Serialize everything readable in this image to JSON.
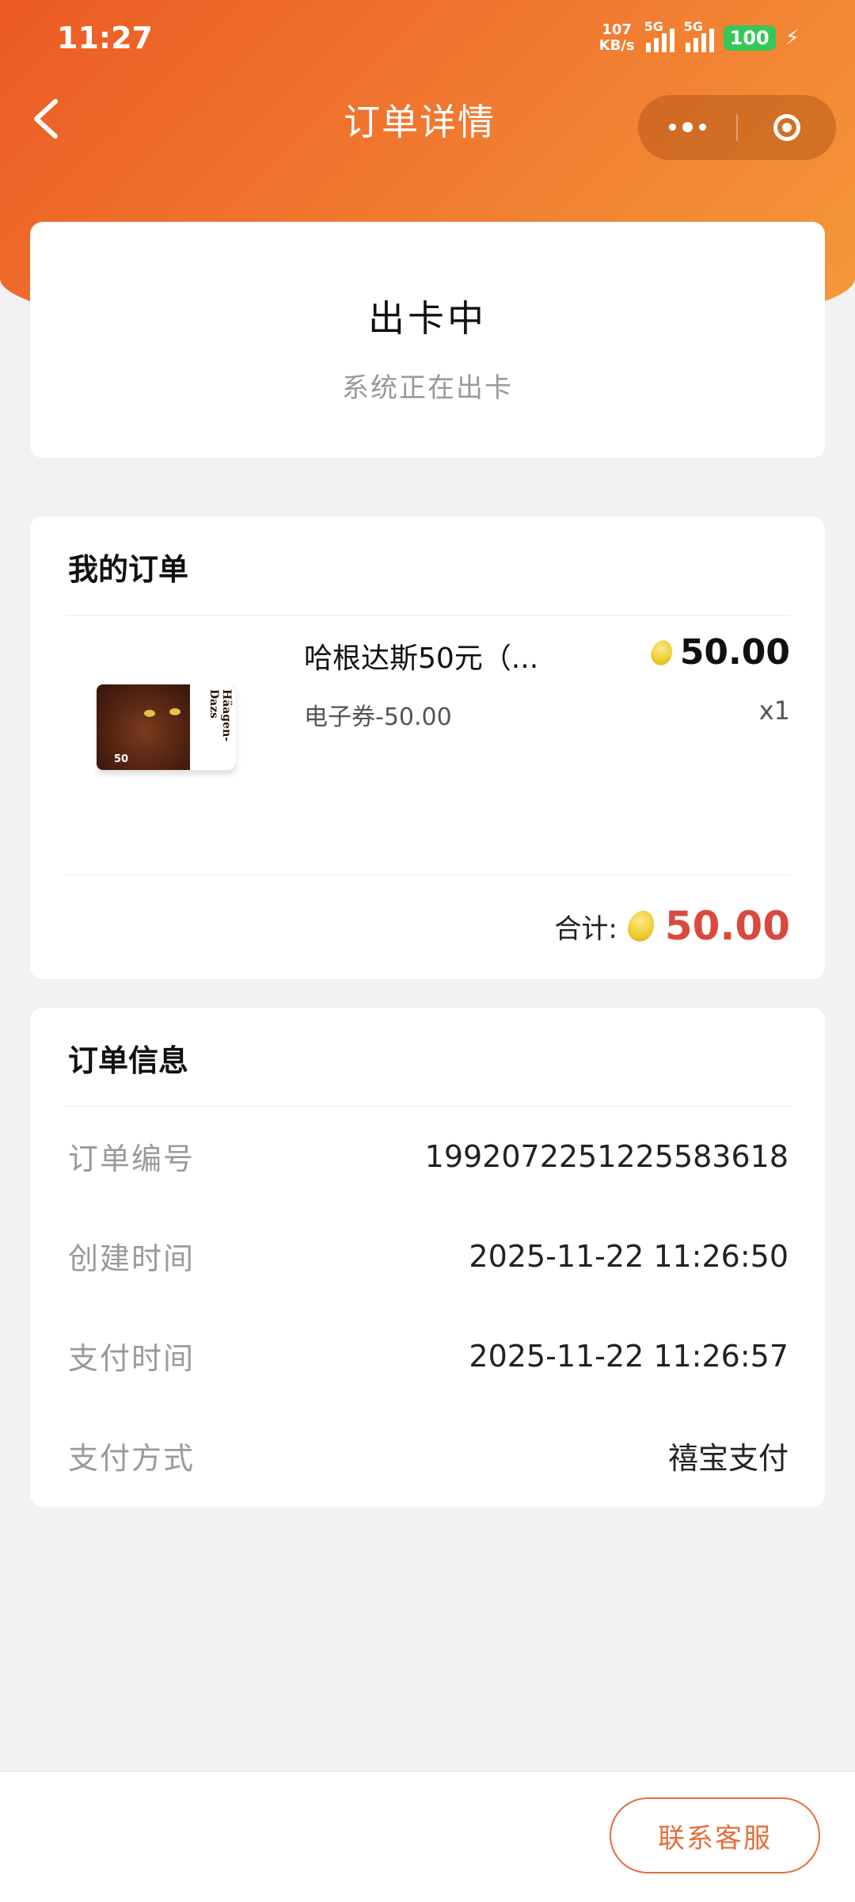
{
  "status_bar": {
    "time": "11:27",
    "net_speed_value": "107",
    "net_speed_unit": "KB/s",
    "network_1": "5G",
    "network_2": "5G",
    "battery": "100"
  },
  "nav": {
    "title": "订单详情",
    "back_icon": "chevron-left-icon",
    "more_icon": "more-dots-icon",
    "close_icon": "target-icon"
  },
  "status_card": {
    "title": "出卡中",
    "subtitle": "系统正在出卡"
  },
  "order": {
    "section_title": "我的订单",
    "product": {
      "name": "哈根达斯50元（...",
      "price": "50.00",
      "spec": "电子券-50.00",
      "quantity": "x1",
      "image_brand_text": "Häagen-Dazs",
      "image_value_text": "50"
    },
    "total_label": "合计:",
    "total_amount": "50.00"
  },
  "info": {
    "section_title": "订单信息",
    "rows": [
      {
        "label": "订单编号",
        "value": "1992072251225583618"
      },
      {
        "label": "创建时间",
        "value": "2025-11-22 11:26:50"
      },
      {
        "label": "支付时间",
        "value": "2025-11-22 11:26:57"
      },
      {
        "label": "支付方式",
        "value": "禧宝支付"
      }
    ]
  },
  "footer": {
    "service_button": "联系客服"
  },
  "colors": {
    "header_start": "#ec5a24",
    "header_end": "#f59a3a",
    "accent_red": "#d94a3c",
    "button_orange": "#e56e3b",
    "background": "#f2f2f2"
  }
}
